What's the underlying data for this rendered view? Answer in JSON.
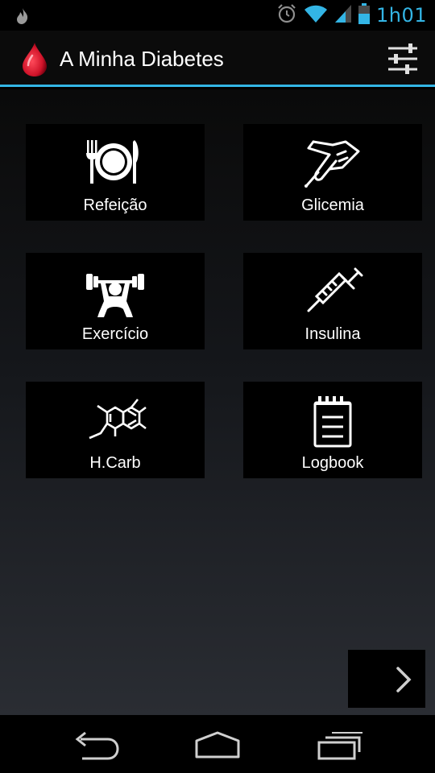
{
  "status_bar": {
    "time": "1h01",
    "accent_color": "#33b5e5",
    "icons": [
      "flame-icon",
      "alarm-icon",
      "wifi-icon",
      "signal-icon",
      "battery-icon"
    ]
  },
  "app": {
    "title": "A Minha Diabetes",
    "logo": "blood-drop-icon",
    "settings_icon": "sliders-icon"
  },
  "menu": {
    "items": [
      {
        "label": "Refeição",
        "icon": "plate-cutlery-icon"
      },
      {
        "label": "Glicemia",
        "icon": "finger-lancet-icon"
      },
      {
        "label": "Exercício",
        "icon": "weightlifter-icon"
      },
      {
        "label": "Insulina",
        "icon": "syringe-icon"
      },
      {
        "label": "H.Carb",
        "icon": "molecule-icon"
      },
      {
        "label": "Logbook",
        "icon": "notepad-icon"
      }
    ]
  },
  "next_button": {
    "icon": "chevron-right-icon"
  },
  "nav_bar": {
    "icons": [
      "back-icon",
      "home-icon",
      "recents-icon"
    ]
  }
}
